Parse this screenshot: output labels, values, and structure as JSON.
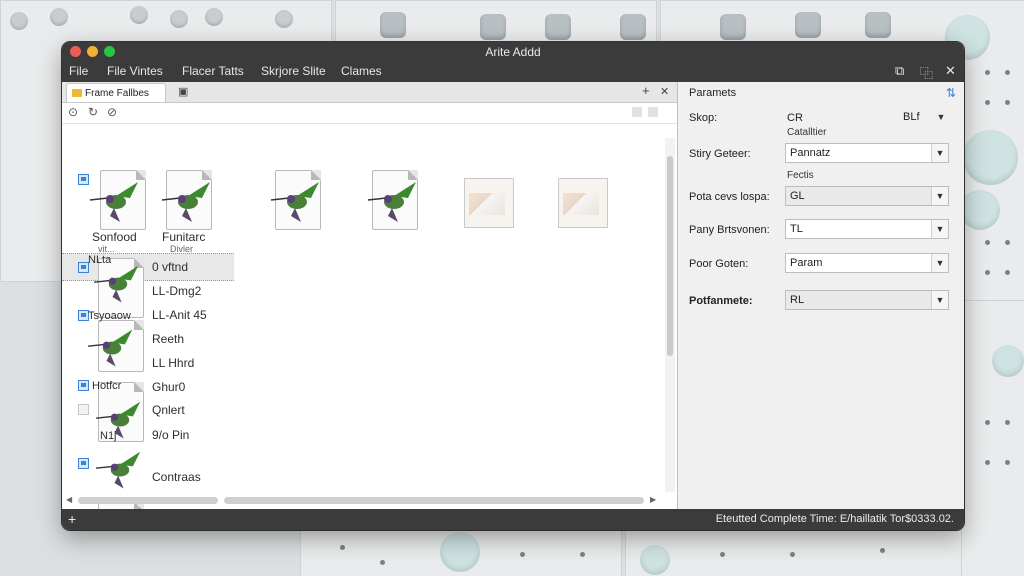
{
  "window": {
    "title": "Arite Addd",
    "controls": {
      "restore": "⧉",
      "tile": "⿻",
      "close": "✕"
    }
  },
  "menubar": {
    "items": [
      "File",
      "File Vintes",
      "Flacer Tatts",
      "Skrjore Slite",
      "Clames"
    ]
  },
  "leftpane": {
    "tab_label": "Frame Fallbes",
    "tab_icons": {
      "pin": "▣",
      "add": "+",
      "close": "✕"
    },
    "toolbar_icons": [
      "⊙",
      "↻",
      "⊘"
    ],
    "thumbnails": [
      {
        "label_line1": "Sonfood",
        "label_line2": "vit..."
      },
      {
        "label_line1": "Funitarc",
        "label_line2": "Divler"
      },
      {
        "label_line1": "",
        "label_line2": ""
      },
      {
        "label_line1": "",
        "label_line2": ""
      }
    ],
    "list_items": [
      {
        "name": "0 vftnd",
        "overlay": "NLta"
      },
      {
        "name": "LL-Dmg2",
        "overlay": ""
      },
      {
        "name": "LL-Anit 45",
        "overlay": "Tsyoaow"
      },
      {
        "name": "Reeth",
        "overlay": ""
      },
      {
        "name": "LL Hhrd",
        "overlay": ""
      },
      {
        "name": "Ghur0",
        "overlay": "Hotfcr"
      },
      {
        "name": "Qnlert",
        "overlay": ""
      },
      {
        "name": "9/o Pin",
        "overlay": "N1j"
      },
      {
        "name": "Contraas",
        "overlay": ""
      }
    ]
  },
  "rightpane": {
    "header": "Paramets",
    "header_icon": "⇅",
    "rows": [
      {
        "label": "Skop:",
        "mid": "CR",
        "sub": "Catalltier",
        "value": "BLf"
      },
      {
        "label": "Stiry Geteer:",
        "value": "Pannatz",
        "sub": "Fectis"
      },
      {
        "label": "Pota cevs lospa:",
        "value": "GL"
      },
      {
        "label": "Pany Brtsvonen:",
        "value": "TL"
      },
      {
        "label": "Poor Goten:",
        "value": "Param"
      },
      {
        "label": "Potfanmete:",
        "value": "RL"
      }
    ]
  },
  "statusbar": {
    "plus": "+",
    "text": "Eteutted Complete Time: E/haillatik Tor$0333.02."
  }
}
